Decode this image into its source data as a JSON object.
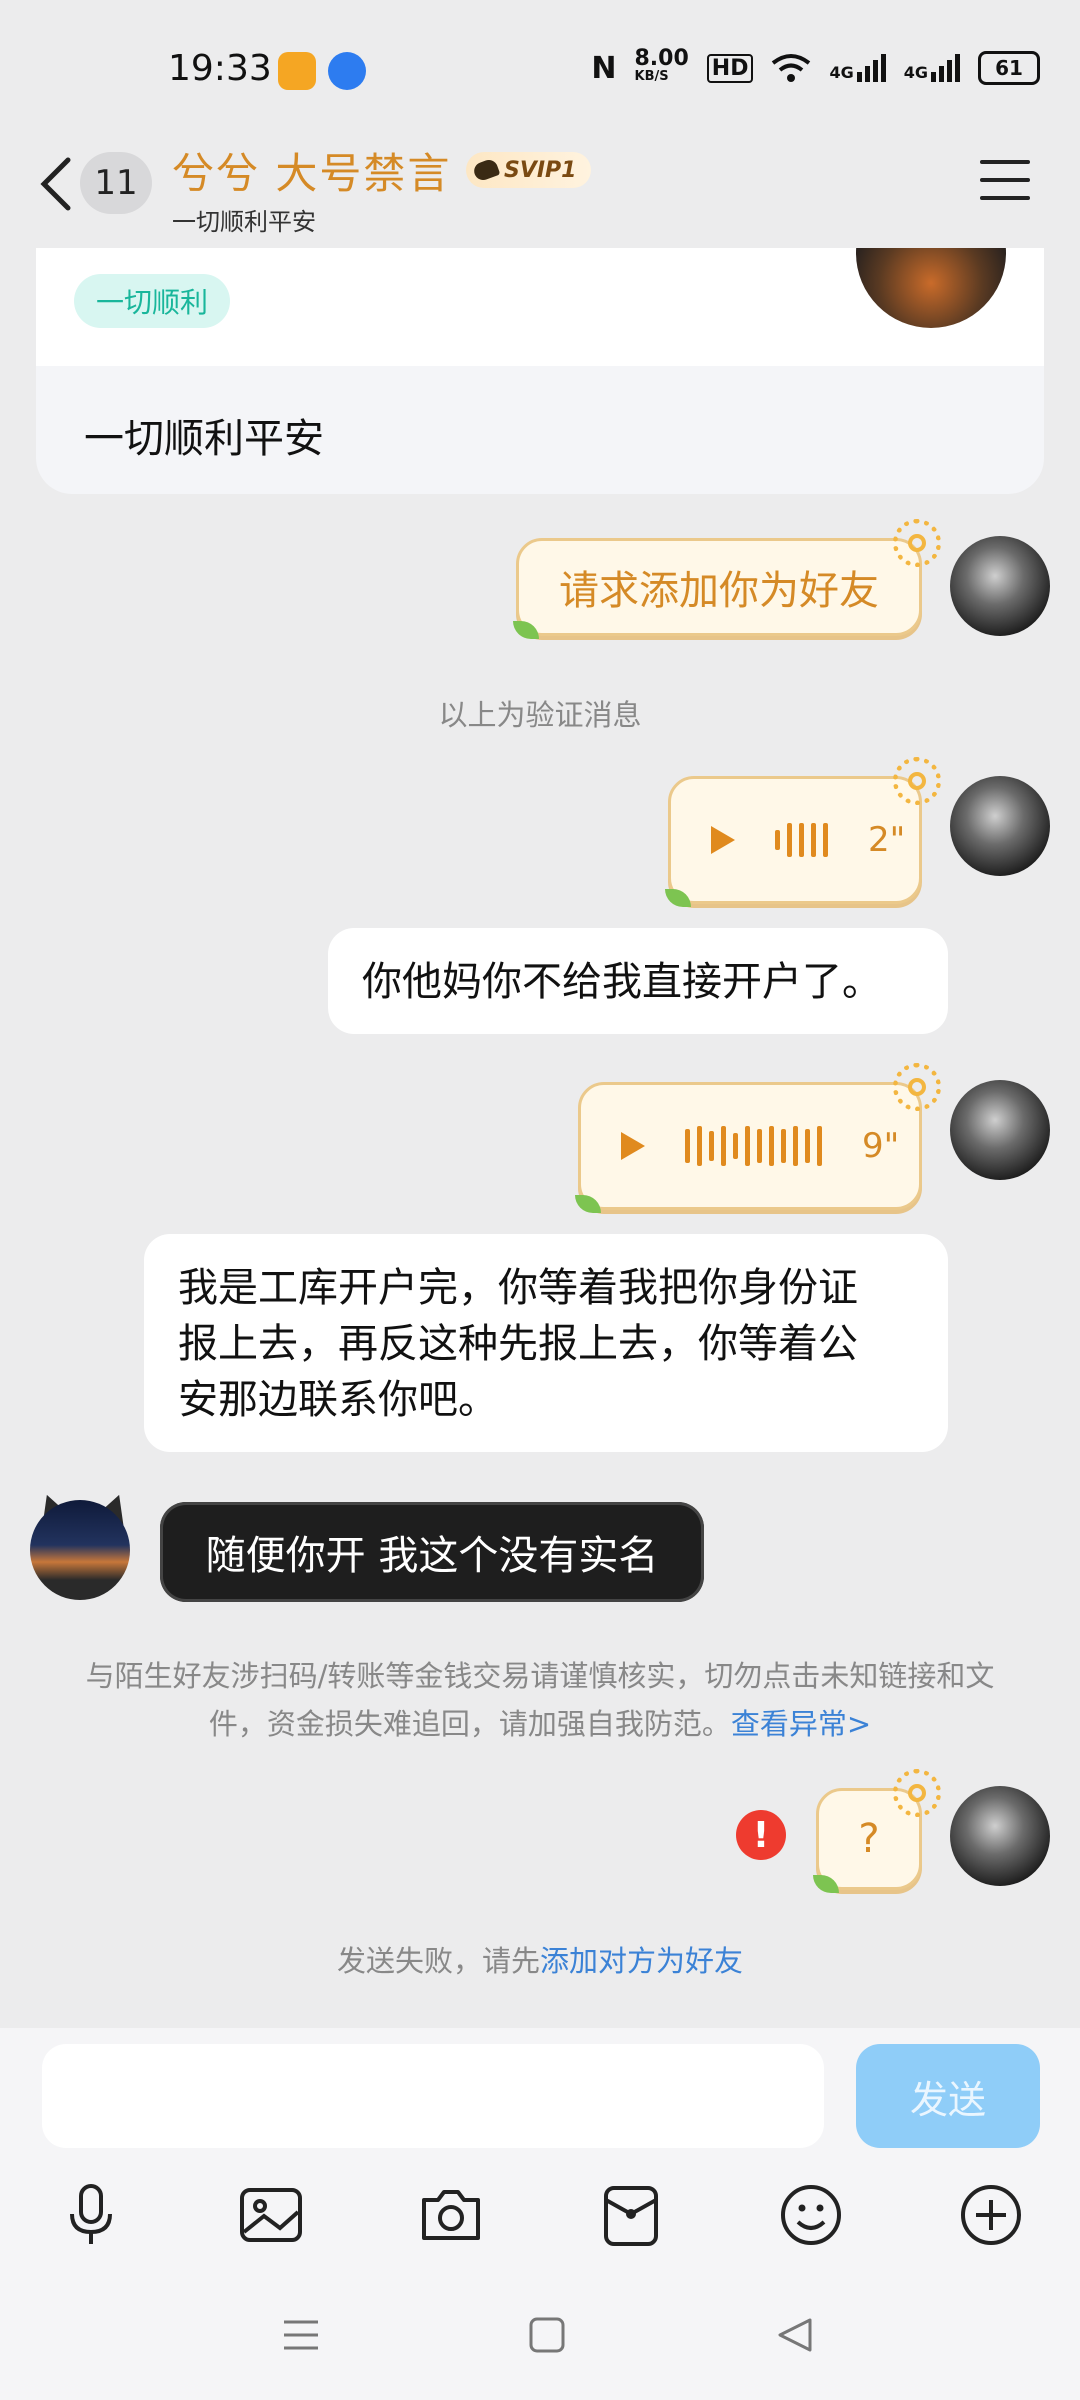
{
  "status": {
    "time": "19:33",
    "speed": "8.00",
    "speed_unit": "KB/S",
    "hd": "HD",
    "net1": "4G",
    "net2": "4G",
    "battery": "61"
  },
  "header": {
    "unread_count": "11",
    "name": "兮兮  大号禁言",
    "badge": "SVIP1",
    "subtitle": "一切顺利平安"
  },
  "profile_card": {
    "tag": "一切顺利",
    "text": "一切顺利平安"
  },
  "messages": {
    "friend_request": "请求添加你为好友",
    "verify_notice": "以上为验证消息",
    "voice1_duration": "2\"",
    "text1": "你他妈你不给我直接开户了。",
    "voice2_duration": "9\"",
    "text2_line1": "我是工库开户完，你等着我把你身份证",
    "text2_line2": "报上去，再反这种先报上去，你等着公",
    "text2_line3": "安那边联系你吧。",
    "reply": "随便你开 我这个没有实名",
    "warning_line1": "与陌生好友涉扫码/转账等金钱交易请谨慎核实，切勿点击未知链接和文",
    "warning_line2": "件，资金损失难追回，请加强自我防范。",
    "warning_link": "查看异常>",
    "failed_msg": "?",
    "fail_notice": "发送失败，请先",
    "fail_link": "添加对方为好友"
  },
  "input": {
    "placeholder": "",
    "send_label": "发送"
  },
  "icons": [
    "back-icon",
    "menu-icon",
    "play-icon",
    "error-icon",
    "mic-icon",
    "image-icon",
    "camera-icon",
    "wallet-icon",
    "emoji-icon",
    "plus-icon",
    "nav-menu-icon",
    "nav-home-icon",
    "nav-back-icon"
  ],
  "colors": {
    "accent_orange": "#d58a26",
    "link_blue": "#3b82d6",
    "send_button": "#8fcdf8",
    "error_red": "#ee3b2f",
    "tag_green": "#19b69b"
  }
}
